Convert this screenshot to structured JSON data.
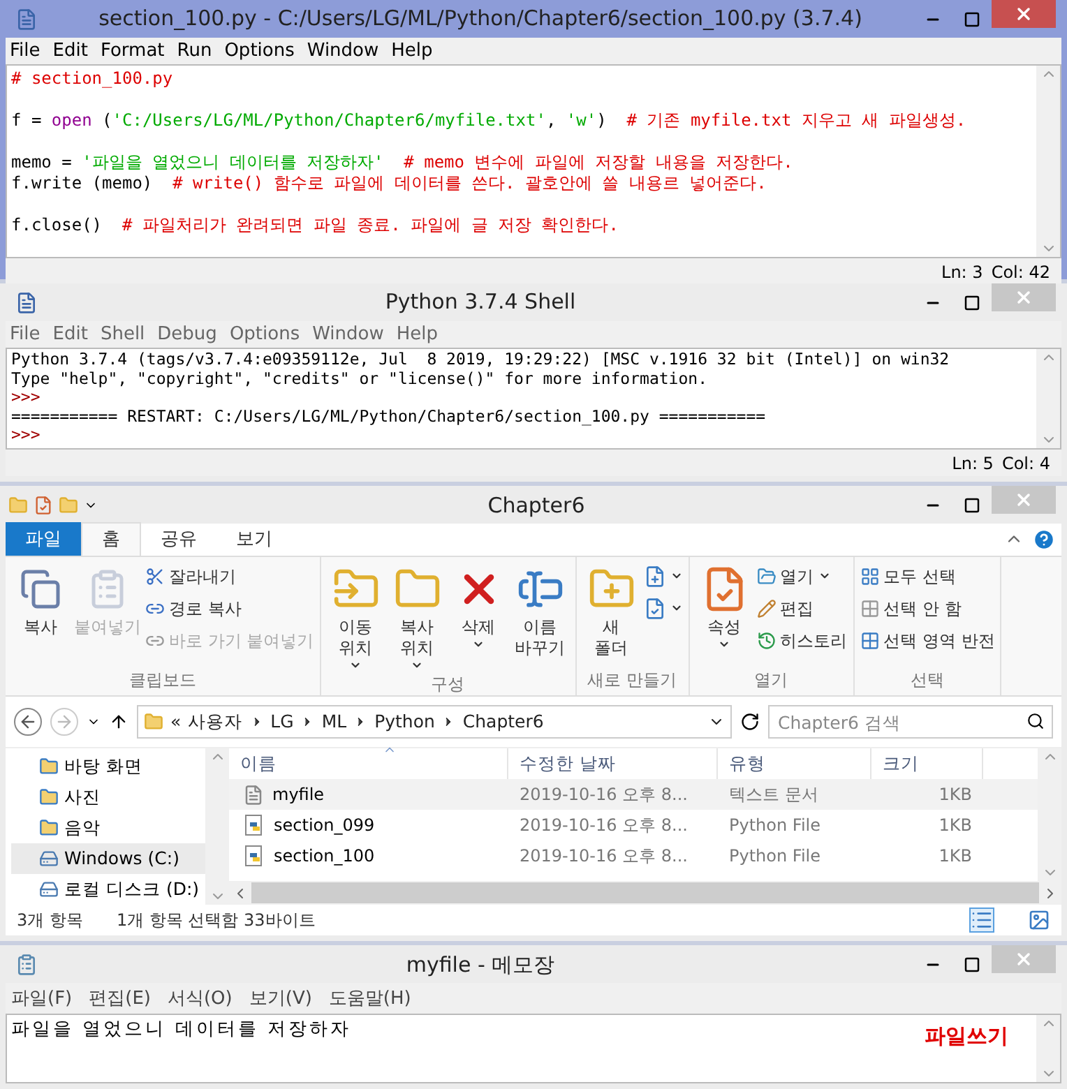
{
  "editor": {
    "title": "section_100.py - C:/Users/LG/ML/Python/Chapter6/section_100.py (3.7.4)",
    "active": true,
    "menu": [
      "File",
      "Edit",
      "Format",
      "Run",
      "Options",
      "Window",
      "Help"
    ],
    "code": [
      {
        "lines": [
          [
            {
              "kind": "comment",
              "text": "# section_100.py"
            }
          ]
        ]
      },
      {
        "lines": [
          [
            {
              "kind": "plain",
              "text": "f = "
            },
            {
              "kind": "builtin",
              "text": "open"
            },
            {
              "kind": "plain",
              "text": " ("
            },
            {
              "kind": "string",
              "text": "'C:/Users/LG/ML/Python/Chapter6/myfile.txt'"
            },
            {
              "kind": "plain",
              "text": ", "
            },
            {
              "kind": "string",
              "text": "'w'"
            },
            {
              "kind": "plain",
              "text": ")  "
            },
            {
              "kind": "comment",
              "text": "# 기존 myfile.txt 지우고 새 파일생성."
            }
          ]
        ]
      },
      {
        "lines": [
          [
            {
              "kind": "plain",
              "text": "memo = "
            },
            {
              "kind": "string",
              "text": "'파일을 열었으니 데이터를 저장하자'"
            },
            {
              "kind": "comment",
              "text": "  # memo 변수에 파일에 저장할 내용을 저장한다."
            }
          ],
          [
            {
              "kind": "plain",
              "text": "f.write (memo)  "
            },
            {
              "kind": "comment",
              "text": "# write() 함수로 파일에 데이터를 쓴다. 괄호안에 쓸 내용르 넣어준다."
            }
          ]
        ]
      },
      {
        "lines": [
          [
            {
              "kind": "plain",
              "text": "f.close()  "
            },
            {
              "kind": "comment",
              "text": "# 파일처리가 완려되면 파일 종료. 파일에 글 저장 확인한다."
            }
          ]
        ]
      }
    ],
    "status": [
      "Ln: 3",
      "Col: 42"
    ]
  },
  "shell": {
    "title": "Python 3.7.4 Shell",
    "active": false,
    "menu": [
      "File",
      "Edit",
      "Shell",
      "Debug",
      "Options",
      "Window",
      "Help"
    ],
    "lines": [
      {
        "kind": "output",
        "text": "Python 3.7.4 (tags/v3.7.4:e09359112e, Jul  8 2019, 19:29:22) [MSC v.1916 32 bit (Intel)] on win32"
      },
      {
        "kind": "output",
        "text": "Type \"help\", \"copyright\", \"credits\" or \"license()\" for more information."
      },
      {
        "kind": "prompt",
        "text": ">>>"
      },
      {
        "kind": "output",
        "text": "=========== RESTART: C:/Users/LG/ML/Python/Chapter6/section_100.py ==========="
      },
      {
        "kind": "prompt",
        "text": ">>>"
      }
    ],
    "status": [
      "Ln: 5",
      "Col: 4"
    ]
  },
  "explorer": {
    "title": "Chapter6",
    "active": false,
    "tabs": [
      {
        "label": "파일",
        "kind": "file",
        "selected": false
      },
      {
        "label": "홈",
        "kind": "tab",
        "selected": true
      },
      {
        "label": "공유",
        "kind": "tab",
        "selected": false
      },
      {
        "label": "보기",
        "kind": "tab",
        "selected": false
      }
    ],
    "groups": [
      {
        "label": "클립보드",
        "items": [
          {
            "kind": "large",
            "label": "복사",
            "disabled": false,
            "dropdown": false
          },
          {
            "kind": "large",
            "label": "붙여넣기",
            "disabled": true,
            "dropdown": false
          },
          {
            "kind": "small",
            "label": "잘라내기",
            "disabled": false,
            "dropdown": false
          },
          {
            "kind": "small",
            "label": "경로 복사",
            "disabled": false,
            "dropdown": false
          },
          {
            "kind": "small",
            "label": "바로 가기 붙여넣기",
            "disabled": true,
            "dropdown": false
          }
        ]
      },
      {
        "label": "구성",
        "items": [
          {
            "kind": "large",
            "label": "이동 위치",
            "disabled": false,
            "dropdown": true
          },
          {
            "kind": "large",
            "label": "복사 위치",
            "disabled": false,
            "dropdown": true
          },
          {
            "kind": "large",
            "label": "삭제",
            "disabled": false,
            "dropdown": true
          },
          {
            "kind": "large",
            "label": "이름 바꾸기",
            "disabled": false,
            "dropdown": false
          }
        ]
      },
      {
        "label": "새로 만들기",
        "items": [
          {
            "kind": "large",
            "label": "새 폴더",
            "disabled": false,
            "dropdown": false
          },
          {
            "kind": "icon",
            "disabled": false,
            "dropdown": true
          },
          {
            "kind": "icon",
            "disabled": false,
            "dropdown": true
          }
        ]
      },
      {
        "label": "열기",
        "items": [
          {
            "kind": "large",
            "label": "속성",
            "disabled": false,
            "dropdown": true
          },
          {
            "kind": "small",
            "label": "열기",
            "disabled": false,
            "dropdown": true
          },
          {
            "kind": "small",
            "label": "편집",
            "disabled": false,
            "dropdown": false
          },
          {
            "kind": "small",
            "label": "히스토리",
            "disabled": false,
            "dropdown": false
          }
        ]
      },
      {
        "label": "선택",
        "items": [
          {
            "kind": "small",
            "label": "모두 선택",
            "disabled": false,
            "dropdown": false
          },
          {
            "kind": "small",
            "label": "선택 안 함",
            "disabled": false,
            "dropdown": false
          },
          {
            "kind": "small",
            "label": "선택 영역 반전",
            "disabled": false,
            "dropdown": false
          }
        ]
      }
    ],
    "address": {
      "overflow": "«",
      "crumbs": [
        "사용자",
        "LG",
        "ML",
        "Python",
        "Chapter6"
      ]
    },
    "search": {
      "placeholder": "Chapter6 검색"
    },
    "nav": [
      {
        "label": "바탕 화면",
        "kind": "folder",
        "selected": false
      },
      {
        "label": "사진",
        "kind": "folder",
        "selected": false
      },
      {
        "label": "음악",
        "kind": "folder",
        "selected": false
      },
      {
        "label": "Windows (C:)",
        "kind": "drive",
        "selected": true
      },
      {
        "label": "로컬 디스크 (D:)",
        "kind": "drive",
        "selected": false
      }
    ],
    "columns": [
      "이름",
      "수정한 날짜",
      "유형",
      "크기"
    ],
    "rows": [
      {
        "name": "myfile",
        "date": "2019-10-16 오후 8...",
        "type": "텍스트 문서",
        "size": "1KB",
        "kind": "text",
        "selected": true
      },
      {
        "name": "section_099",
        "date": "2019-10-16 오후 8...",
        "type": "Python File",
        "size": "1KB",
        "kind": "python",
        "selected": false
      },
      {
        "name": "section_100",
        "date": "2019-10-16 오후 8...",
        "type": "Python File",
        "size": "1KB",
        "kind": "python",
        "selected": false
      }
    ],
    "status": [
      "3개 항목",
      "1개 항목 선택함 33바이트"
    ]
  },
  "notepad": {
    "title": "myfile - 메모장",
    "active": false,
    "menu": [
      "파일(F)",
      "편집(E)",
      "서식(O)",
      "보기(V)",
      "도움말(H)"
    ],
    "text": "파일을 열었으니 데이터를 저장하자",
    "annotation": "파일쓰기"
  }
}
